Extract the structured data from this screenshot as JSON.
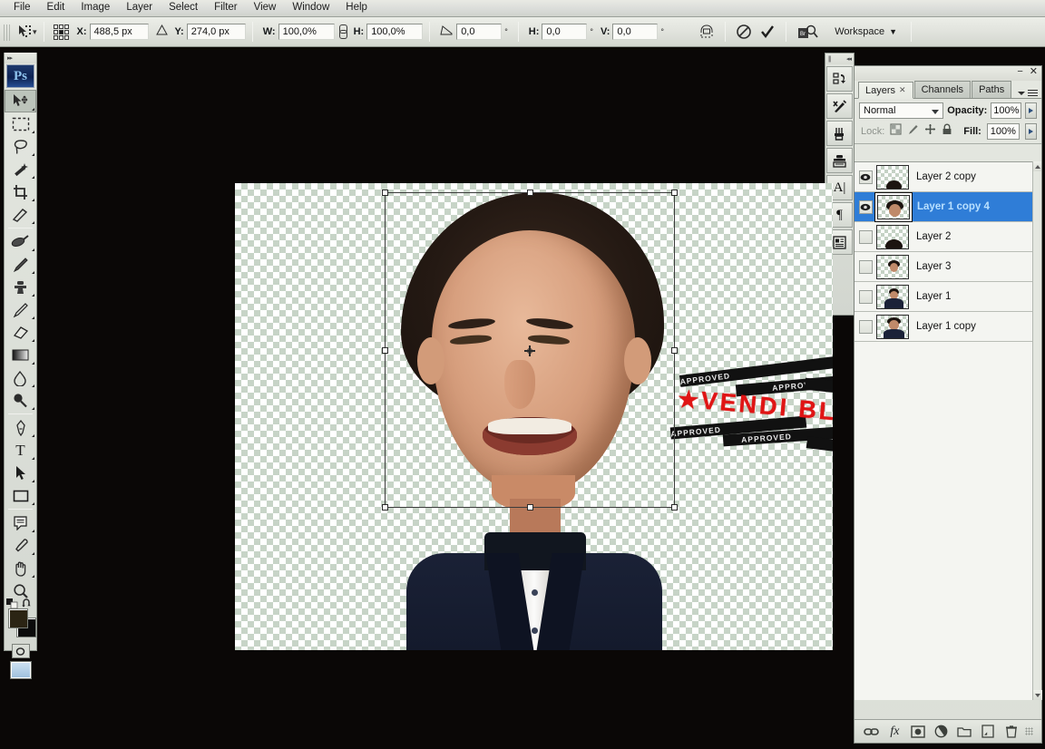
{
  "app": {
    "name": "Adobe Photoshop",
    "logo_text": "Ps"
  },
  "menubar": {
    "items": [
      {
        "label": "File"
      },
      {
        "label": "Edit"
      },
      {
        "label": "Image"
      },
      {
        "label": "Layer"
      },
      {
        "label": "Select"
      },
      {
        "label": "Filter"
      },
      {
        "label": "View"
      },
      {
        "label": "Window"
      },
      {
        "label": "Help"
      }
    ]
  },
  "options_bar": {
    "active_tool": "move-tool",
    "reference_point_label": "reference-point-grid",
    "fields": [
      {
        "name": "x",
        "label": "X:",
        "value": "488,5 px"
      },
      {
        "name": "y",
        "label": "Y:",
        "value": "274,0 px"
      },
      {
        "name": "w",
        "label": "W:",
        "value": "100,0%"
      },
      {
        "name": "h",
        "label": "H:",
        "value": "100,0%"
      },
      {
        "name": "rotate",
        "label": "",
        "value": "0,0",
        "unit": "°"
      },
      {
        "name": "skew_h",
        "label": "H:",
        "value": "0,0",
        "unit": "°"
      },
      {
        "name": "skew_v",
        "label": "V:",
        "value": "0,0",
        "unit": "°"
      }
    ],
    "buttons": [
      {
        "name": "warp-mode-button",
        "icon": "warp-icon"
      },
      {
        "name": "cancel-transform-button",
        "icon": "cancel-icon"
      },
      {
        "name": "commit-transform-button",
        "icon": "checkmark-icon"
      },
      {
        "name": "bridge-button",
        "icon": "bridge-icon"
      }
    ],
    "workspace_label": "Workspace"
  },
  "toolbox": {
    "tools": [
      {
        "name": "move-tool",
        "selected": true
      },
      {
        "name": "rectangular-marquee-tool",
        "selected": false
      },
      {
        "name": "lasso-tool",
        "selected": false
      },
      {
        "name": "magic-wand-tool",
        "selected": false
      },
      {
        "name": "crop-tool",
        "selected": false
      },
      {
        "name": "slice-tool",
        "selected": false
      },
      {
        "name": "healing-brush-tool",
        "selected": false
      },
      {
        "name": "brush-tool",
        "selected": false
      },
      {
        "name": "clone-stamp-tool",
        "selected": false
      },
      {
        "name": "history-brush-tool",
        "selected": false
      },
      {
        "name": "eraser-tool",
        "selected": false
      },
      {
        "name": "gradient-tool",
        "selected": false
      },
      {
        "name": "blur-tool",
        "selected": false
      },
      {
        "name": "dodge-tool",
        "selected": false
      },
      {
        "name": "pen-tool",
        "selected": false
      },
      {
        "name": "type-tool",
        "selected": false
      },
      {
        "name": "path-selection-tool",
        "selected": false
      },
      {
        "name": "rectangle-shape-tool",
        "selected": false
      },
      {
        "name": "notes-tool",
        "selected": false
      },
      {
        "name": "eyedropper-tool",
        "selected": false
      },
      {
        "name": "hand-tool",
        "selected": false
      },
      {
        "name": "zoom-tool",
        "selected": false
      }
    ],
    "foreground_color": "#2b2414",
    "background_color": "#0b0b0b"
  },
  "icon_dock": {
    "buttons": [
      {
        "name": "history-panel-button",
        "icon": "history-icon"
      },
      {
        "name": "tool-presets-panel-button",
        "icon": "tool-presets-icon"
      },
      {
        "name": "brushes-panel-button",
        "icon": "brushes-icon"
      },
      {
        "name": "clone-source-panel-button",
        "icon": "clone-source-icon"
      },
      {
        "name": "character-panel-button",
        "icon": "character-a-icon"
      },
      {
        "name": "paragraph-panel-button",
        "icon": "paragraph-pilcrow-icon"
      },
      {
        "name": "layer-comps-panel-button",
        "icon": "layer-comps-icon"
      }
    ]
  },
  "layers_panel": {
    "tabs": [
      {
        "label": "Layers",
        "active": true,
        "closable": true
      },
      {
        "label": "Channels",
        "active": false,
        "closable": false
      },
      {
        "label": "Paths",
        "active": false,
        "closable": false
      }
    ],
    "blend_mode": "Normal",
    "opacity_label": "Opacity:",
    "opacity_value": "100%",
    "lock_label": "Lock:",
    "lock_buttons": [
      {
        "name": "lock-transparent-pixels-button",
        "icon": "checkerboard-icon"
      },
      {
        "name": "lock-image-pixels-button",
        "icon": "brush-icon"
      },
      {
        "name": "lock-position-button",
        "icon": "move-arrows-icon"
      },
      {
        "name": "lock-all-button",
        "icon": "padlock-icon"
      }
    ],
    "fill_label": "Fill:",
    "fill_value": "100%",
    "layers": [
      {
        "name": "Layer 2 copy",
        "visible": true,
        "selected": false,
        "thumb": "hair"
      },
      {
        "name": "Layer 1 copy 4",
        "visible": true,
        "selected": true,
        "thumb": "face"
      },
      {
        "name": "Layer 2",
        "visible": false,
        "selected": false,
        "thumb": "hair"
      },
      {
        "name": "Layer 3",
        "visible": false,
        "selected": false,
        "thumb": "face"
      },
      {
        "name": "Layer 1",
        "visible": false,
        "selected": false,
        "thumb": "portrait"
      },
      {
        "name": "Layer 1 copy",
        "visible": false,
        "selected": false,
        "thumb": "portrait"
      }
    ],
    "footer_buttons": [
      {
        "name": "link-layers-button",
        "icon": "chain-link-icon"
      },
      {
        "name": "layer-style-button",
        "icon": "fx-icon"
      },
      {
        "name": "add-layer-mask-button",
        "icon": "layer-mask-icon"
      },
      {
        "name": "adjustment-layer-button",
        "icon": "half-circle-icon"
      },
      {
        "name": "new-group-button",
        "icon": "folder-icon"
      },
      {
        "name": "new-layer-button",
        "icon": "new-page-icon"
      },
      {
        "name": "delete-layer-button",
        "icon": "trash-icon"
      }
    ]
  },
  "canvas": {
    "transform_active": true,
    "watermark": {
      "text_left": "VENDI",
      "text_right": "BLOG",
      "star": "★",
      "color": "#e01515",
      "stamp_text": "APPROVED"
    }
  }
}
